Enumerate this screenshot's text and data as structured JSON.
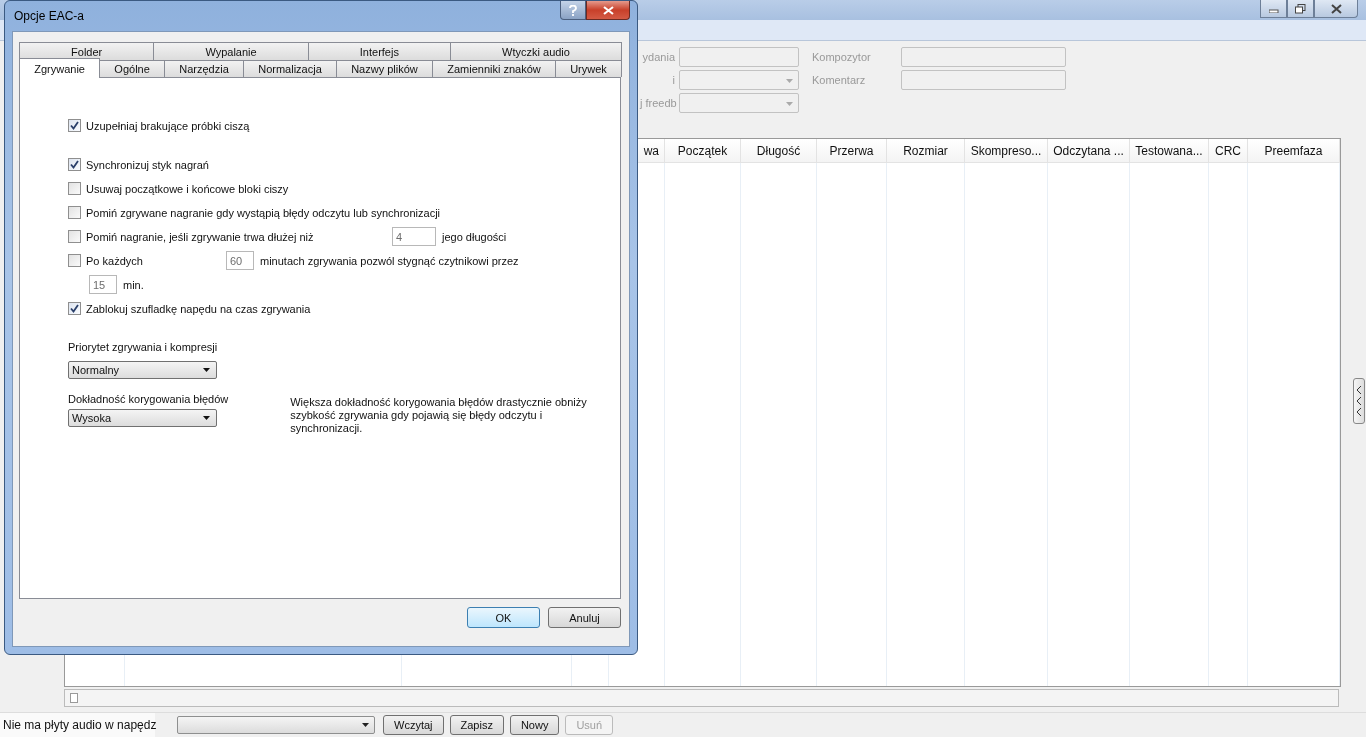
{
  "main_window": {
    "form": [
      {
        "label": "ydania",
        "kind": "text",
        "field_label": "Kompozytor"
      },
      {
        "label": "i",
        "kind": "combo",
        "field_label": "Komentarz"
      },
      {
        "label": "j freedb",
        "kind": "combo"
      }
    ],
    "table": {
      "columns": [
        "wa",
        "Początek",
        "Długość",
        "Przerwa",
        "Rozmiar",
        "Skompreso...",
        "Odczytana ...",
        "Testowana...",
        "CRC",
        "Preemfaza"
      ]
    },
    "status": "Nie ma płyty audio w napędz",
    "buttons": [
      {
        "label": "Wczytaj",
        "disabled": false
      },
      {
        "label": "Zapisz",
        "disabled": false
      },
      {
        "label": "Nowy",
        "disabled": false
      },
      {
        "label": "Usuń",
        "disabled": true
      }
    ]
  },
  "dialog": {
    "title": "Opcje EAC-a",
    "tab_rows": [
      [
        {
          "label": "Folder",
          "selected": false
        },
        {
          "label": "Wypalanie",
          "selected": false
        },
        {
          "label": "Interfejs",
          "selected": false
        },
        {
          "label": "Wtyczki audio",
          "selected": false
        }
      ],
      [
        {
          "label": "Zgrywanie",
          "selected": true
        },
        {
          "label": "Ogólne",
          "selected": false
        },
        {
          "label": "Narzędzia",
          "selected": false
        },
        {
          "label": "Normalizacja",
          "selected": false
        },
        {
          "label": "Nazwy plików",
          "selected": false
        },
        {
          "label": "Zamienniki znaków",
          "selected": false
        },
        {
          "label": "Urywek",
          "selected": false
        }
      ]
    ],
    "option_groups": [
      [
        {
          "kind": "checkbox",
          "label": "Uzupełniaj brakujące próbki ciszą",
          "checked": true
        }
      ],
      [
        {
          "kind": "checkbox",
          "label": "Synchronizuj styk nagrań",
          "checked": true
        },
        {
          "kind": "checkbox",
          "label": "Usuwaj początkowe i końcowe bloki ciszy",
          "checked": false
        },
        {
          "kind": "checkbox",
          "label": "Pomiń zgrywane nagranie gdy wystąpią błędy odczytu lub synchronizacji",
          "checked": false
        },
        {
          "kind": "limit",
          "label": "Pomiń nagranie, jeśli zgrywanie trwa dłużej niż",
          "checked": false,
          "value": "4",
          "suffix": "jego długości"
        },
        {
          "kind": "timer",
          "label": "Po każdych",
          "checked": false,
          "value": "60",
          "suffix": "minutach zgrywania pozwól stygnąć czytnikowi przez",
          "value2": "15",
          "suffix2": "min."
        },
        {
          "kind": "checkbox",
          "label": "Zablokuj szufladkę napędu na czas zgrywania",
          "checked": true
        }
      ]
    ],
    "priority": {
      "label": "Priorytet zgrywania i kompresji",
      "value": "Normalny"
    },
    "accuracy": {
      "label": "Dokładność korygowania błędów",
      "value": "Wysoka",
      "note": "Większa dokładność korygowania błędów drastycznie obniży szybkość zgrywania gdy pojawią się błędy odczytu i synchronizacji."
    },
    "buttons": [
      "OK",
      "Anuluj"
    ]
  }
}
